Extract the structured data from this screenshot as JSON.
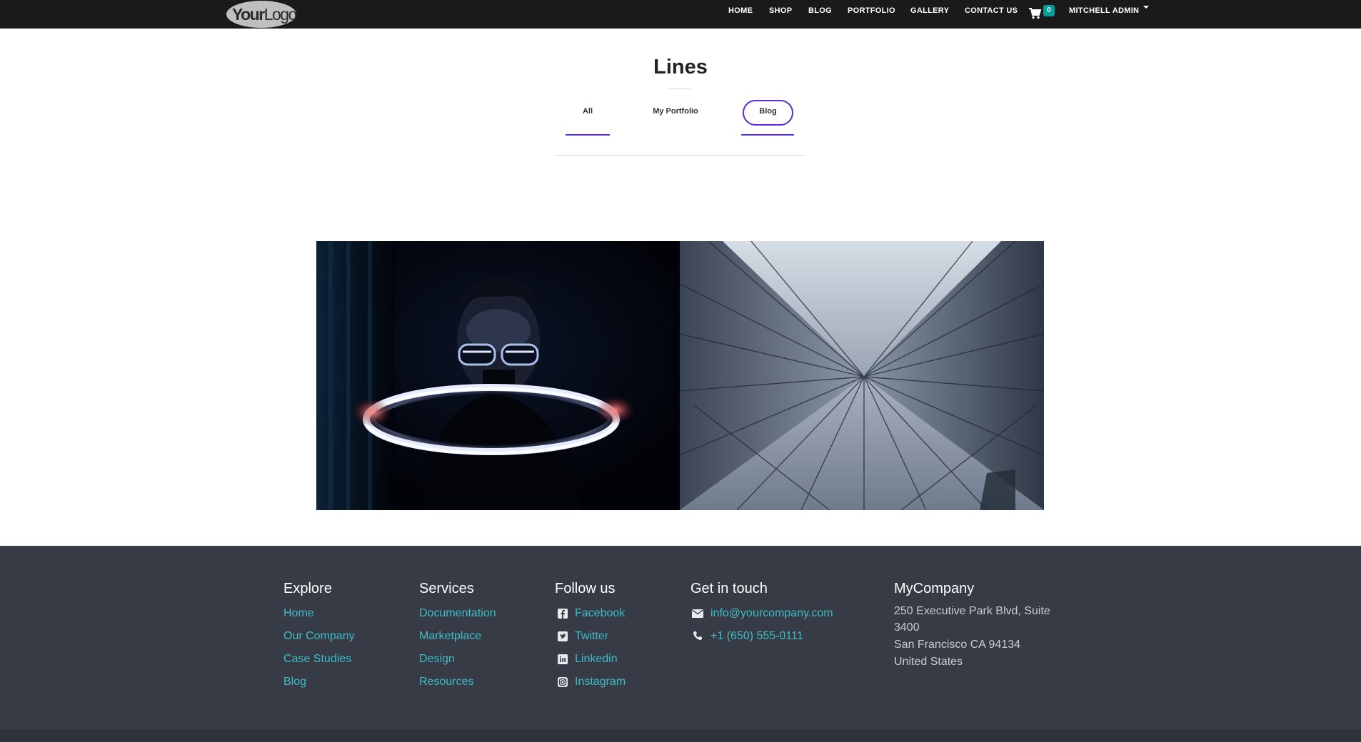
{
  "header": {
    "logo": {
      "bold": "Your",
      "light": "Logo"
    },
    "nav": [
      "HOME",
      "SHOP",
      "BLOG",
      "PORTFOLIO",
      "GALLERY",
      "CONTACT US"
    ],
    "cart_count": "0",
    "user": "MITCHELL ADMIN"
  },
  "page": {
    "title": "Lines",
    "tabs": [
      {
        "label": "All"
      },
      {
        "label": "My Portfolio"
      },
      {
        "label": "Blog",
        "active": true
      }
    ]
  },
  "footer": {
    "explore": {
      "title": "Explore",
      "links": [
        "Home",
        "Our Company",
        "Case Studies",
        "Blog"
      ]
    },
    "services": {
      "title": "Services",
      "links": [
        "Documentation",
        "Marketplace",
        "Design",
        "Resources"
      ]
    },
    "follow": {
      "title": "Follow us",
      "links": [
        "Facebook",
        "Twitter",
        "Linkedin",
        "Instagram"
      ]
    },
    "contact": {
      "title": "Get in touch",
      "email": "info@yourcompany.com",
      "phone": "+1 (650) 555-0111"
    },
    "company": {
      "title": "MyCompany",
      "address": [
        "250 Executive Park Blvd, Suite",
        "3400",
        "San Francisco CA 94134",
        "United States"
      ]
    }
  },
  "colors": {
    "accent": "#5d2fd7",
    "link": "#3fbcc5",
    "footer_bg": "#373b45",
    "badge": "#00a09d"
  }
}
